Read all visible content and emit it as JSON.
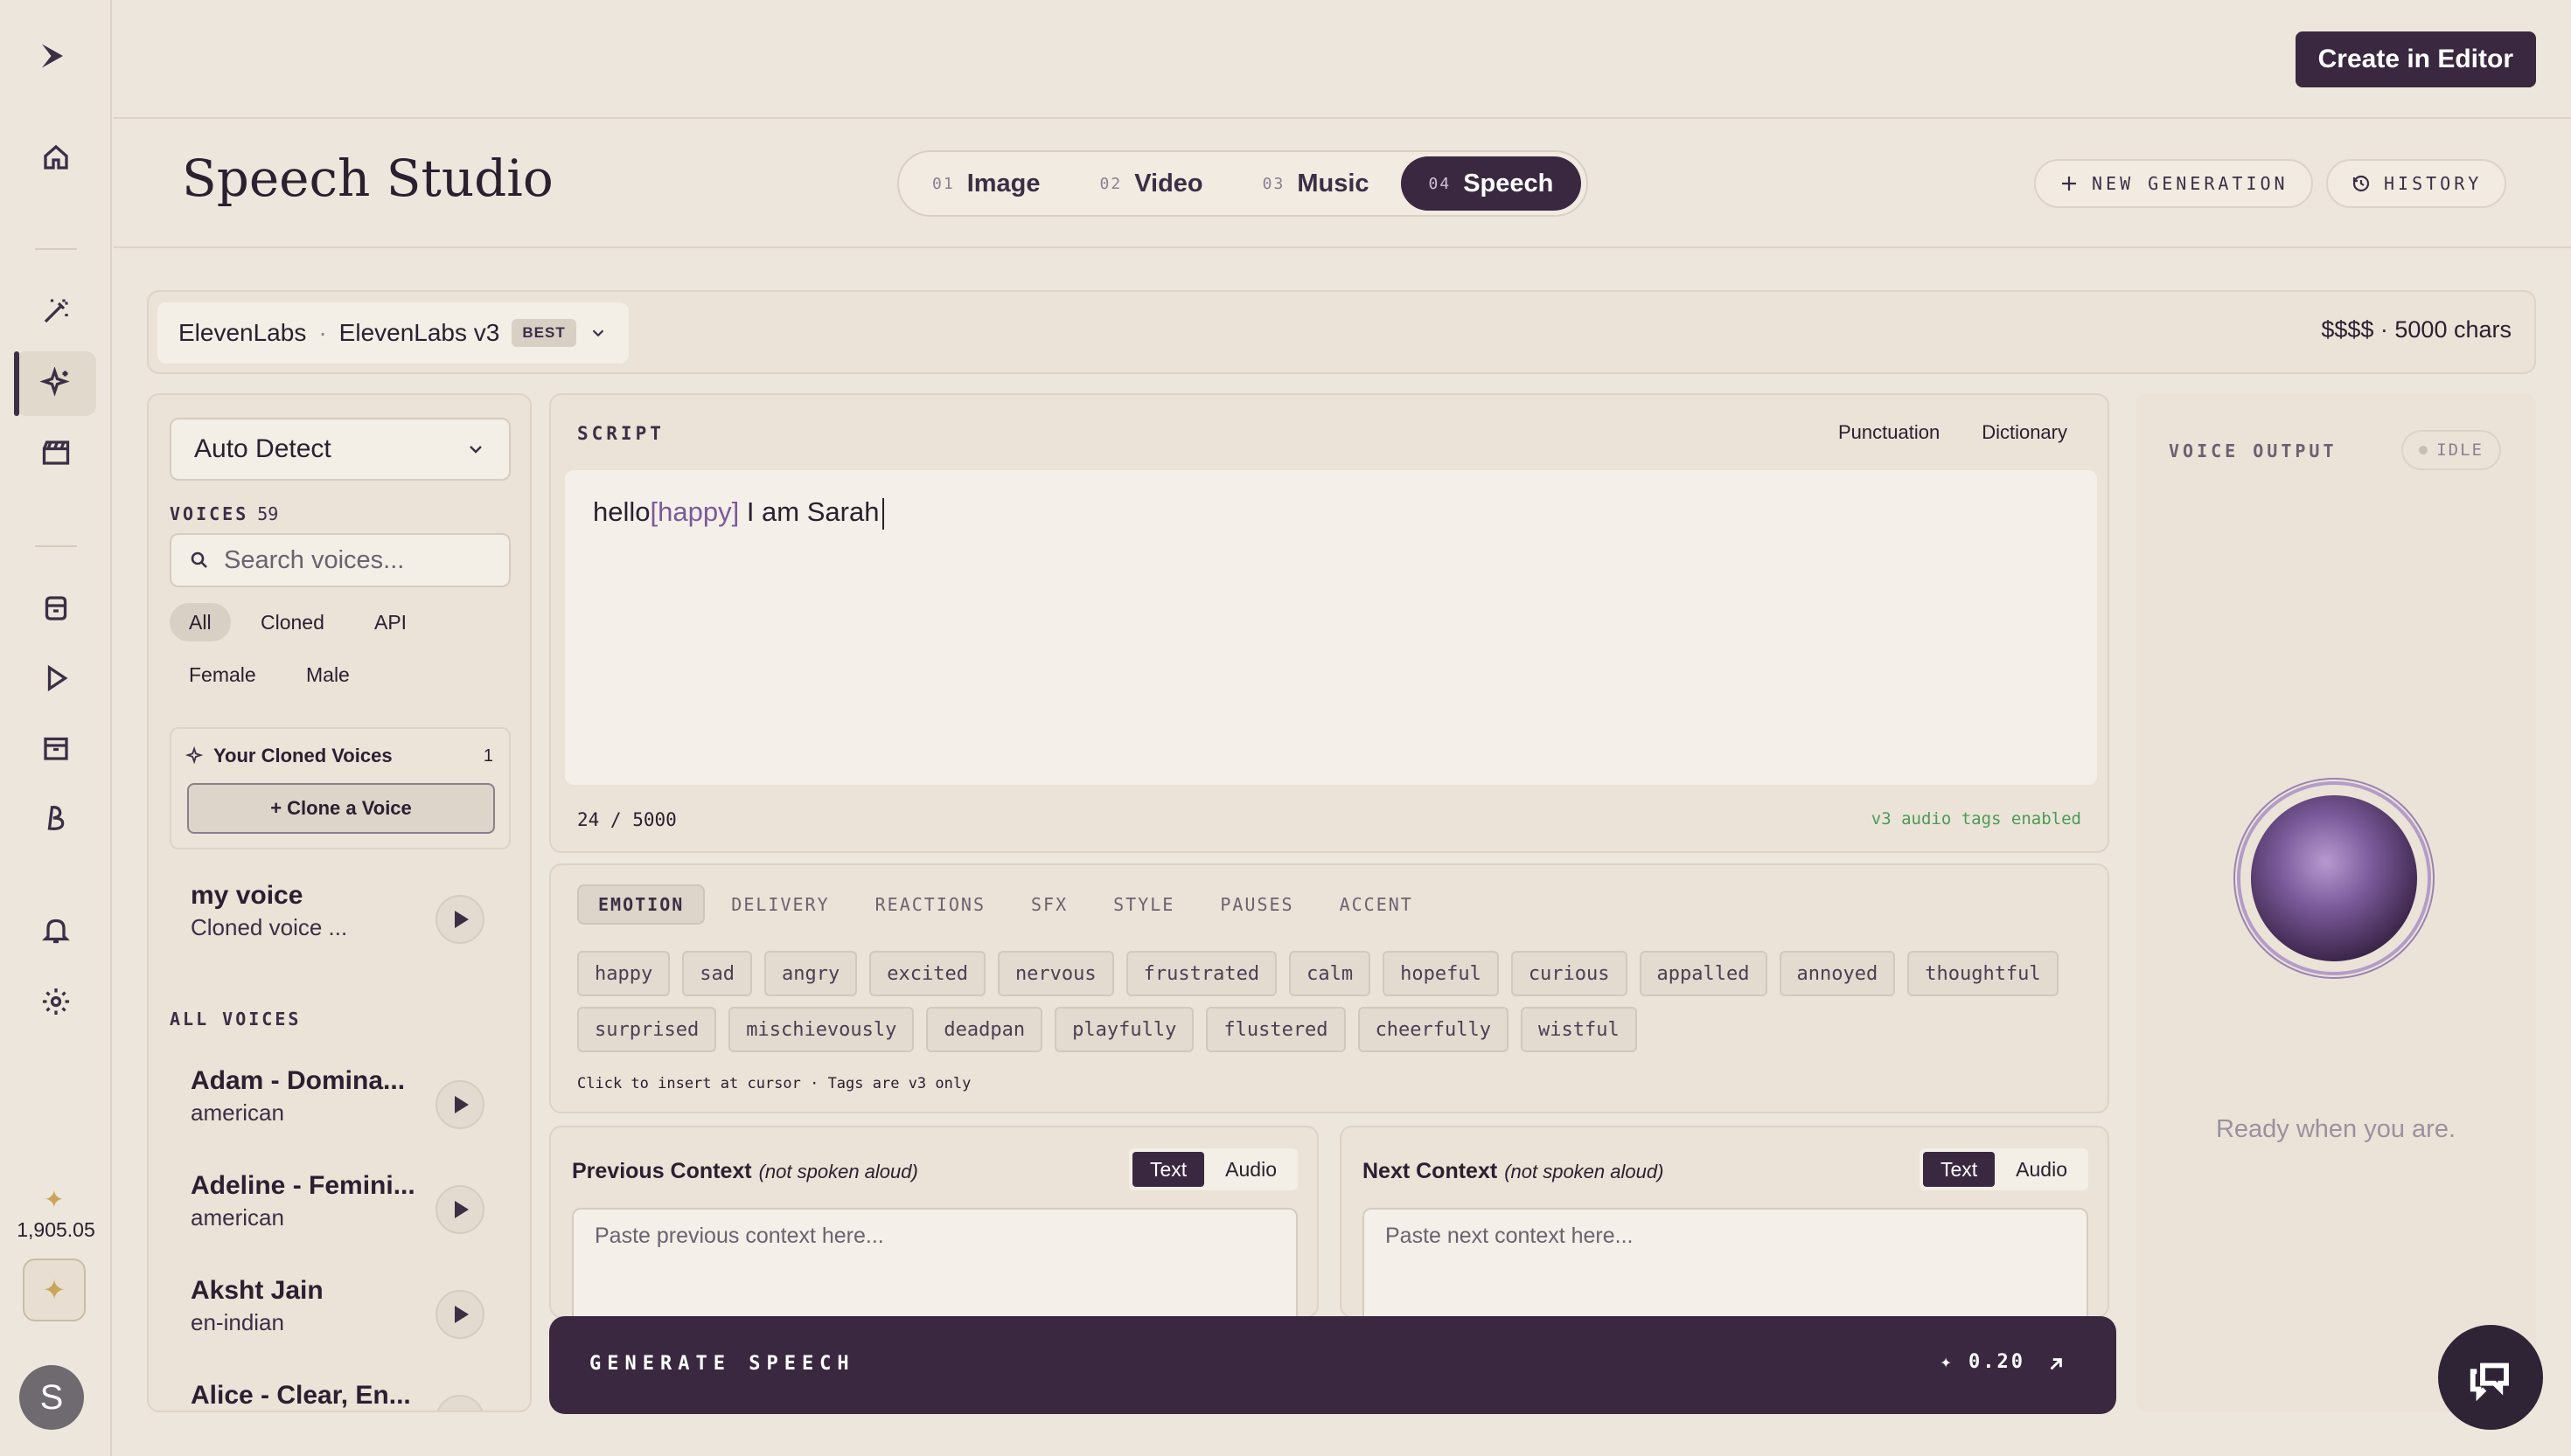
{
  "top": {
    "create_button": "Create in Editor"
  },
  "credits": {
    "balance": "1,905.05"
  },
  "user": {
    "initial": "S"
  },
  "header": {
    "title": "Speech Studio",
    "modes": [
      {
        "num": "01",
        "label": "Image"
      },
      {
        "num": "02",
        "label": "Video"
      },
      {
        "num": "03",
        "label": "Music"
      },
      {
        "num": "04",
        "label": "Speech"
      }
    ],
    "new_generation": "NEW GENERATION",
    "history": "HISTORY"
  },
  "model": {
    "provider": "ElevenLabs",
    "name": "ElevenLabs v3",
    "badge": "BEST",
    "price": "$$$$ · 5000 chars"
  },
  "voices": {
    "language": "Auto Detect",
    "label": "VOICES",
    "count": "59",
    "search_placeholder": "Search voices...",
    "filters": [
      "All",
      "Cloned",
      "API",
      "Female",
      "Male"
    ],
    "cloned_title": "Your Cloned Voices",
    "cloned_count": "1",
    "clone_button": "+ Clone a Voice",
    "cloned_items": [
      {
        "name": "my voice",
        "sub": "Cloned voice ..."
      }
    ],
    "all_label": "ALL VOICES",
    "items": [
      {
        "name": "Adam - Domina...",
        "sub": "american"
      },
      {
        "name": "Adeline - Femini...",
        "sub": "american"
      },
      {
        "name": "Aksht Jain",
        "sub": "en-indian"
      },
      {
        "name": "Alice - Clear, En...",
        "sub": ""
      }
    ]
  },
  "script": {
    "label": "SCRIPT",
    "punctuation": "Punctuation",
    "dictionary": "Dictionary",
    "text_before": "hello",
    "text_tag": "[happy]",
    "text_after": " I am Sarah",
    "char_count": "24 / 5000",
    "tags_enabled": "v3 audio tags enabled"
  },
  "tags": {
    "tabs": [
      "EMOTION",
      "DELIVERY",
      "REACTIONS",
      "SFX",
      "STYLE",
      "PAUSES",
      "ACCENT"
    ],
    "row1": [
      "happy",
      "sad",
      "angry",
      "excited",
      "nervous",
      "frustrated",
      "calm",
      "hopeful",
      "curious",
      "appalled",
      "annoyed",
      "thoughtful"
    ],
    "row2": [
      "surprised",
      "mischievously",
      "deadpan",
      "playfully",
      "flustered",
      "cheerfully",
      "wistful"
    ],
    "hint": "Click to insert at cursor · Tags are v3 only"
  },
  "context": {
    "prev_title": "Previous Context",
    "next_title": "Next Context",
    "sub": "(not spoken aloud)",
    "text_label": "Text",
    "audio_label": "Audio",
    "prev_placeholder": "Paste previous context here...",
    "next_placeholder": "Paste next context here..."
  },
  "generate": {
    "label": "GENERATE SPEECH",
    "cost": "✦ 0.20"
  },
  "output": {
    "label": "VOICE OUTPUT",
    "status": "IDLE",
    "ready": "Ready when you are."
  }
}
